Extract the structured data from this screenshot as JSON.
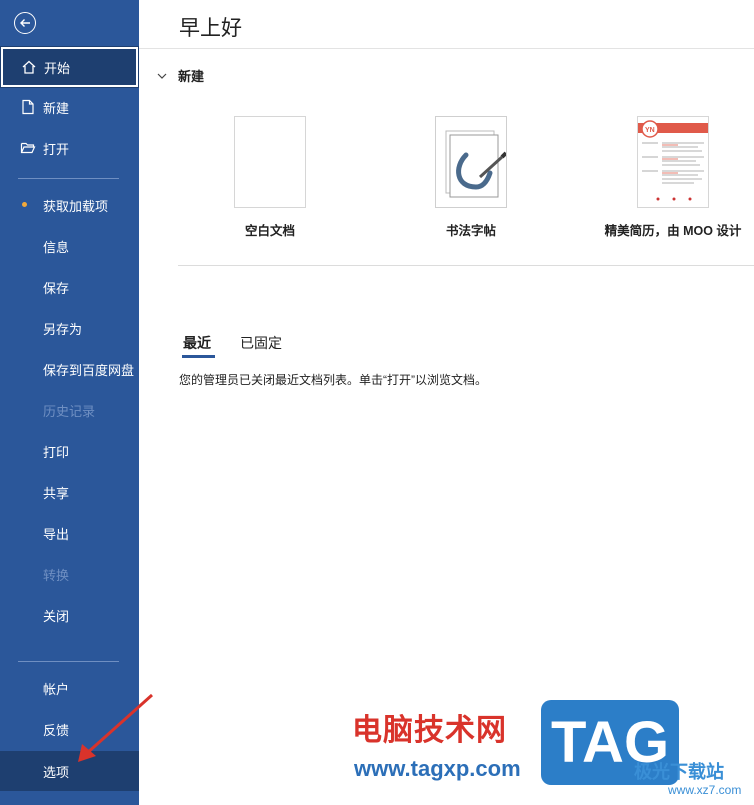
{
  "sidebar": {
    "items": [
      {
        "label": "开始"
      },
      {
        "label": "新建"
      },
      {
        "label": "打开"
      },
      {
        "label": "获取加载项"
      },
      {
        "label": "信息"
      },
      {
        "label": "保存"
      },
      {
        "label": "另存为"
      },
      {
        "label": "保存到百度网盘"
      },
      {
        "label": "历史记录"
      },
      {
        "label": "打印"
      },
      {
        "label": "共享"
      },
      {
        "label": "导出"
      },
      {
        "label": "转换"
      },
      {
        "label": "关闭"
      },
      {
        "label": "帐户"
      },
      {
        "label": "反馈"
      },
      {
        "label": "选项"
      }
    ]
  },
  "main": {
    "greeting": "早上好",
    "new_section": "新建",
    "templates": [
      {
        "label": "空白文档"
      },
      {
        "label": "书法字帖"
      },
      {
        "label": "精美简历，由 MOO 设计"
      }
    ],
    "tabs": [
      {
        "label": "最近"
      },
      {
        "label": "已固定"
      }
    ],
    "info": "您的管理员已关闭最近文档列表。单击“打开”以浏览文档。"
  },
  "watermark": {
    "line1": "电脑技术网",
    "line2": "www.tagxp.com",
    "tag": "TAG",
    "xz": "极光下载站",
    "xz_url": "www.xz7.com"
  },
  "colors": {
    "sidebar": "#2b579a",
    "sidebar_active": "#1e3f70",
    "dot": "#f2a93b"
  }
}
